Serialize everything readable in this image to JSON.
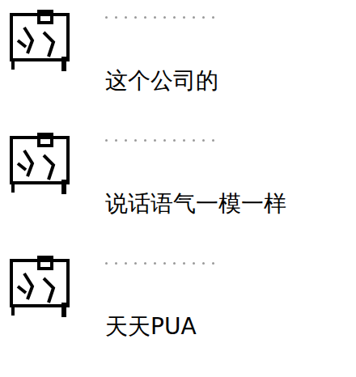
{
  "messages": [
    {
      "text": "这个公司的"
    },
    {
      "text": "说话语气一模一样"
    },
    {
      "text": "天天PUA"
    }
  ]
}
